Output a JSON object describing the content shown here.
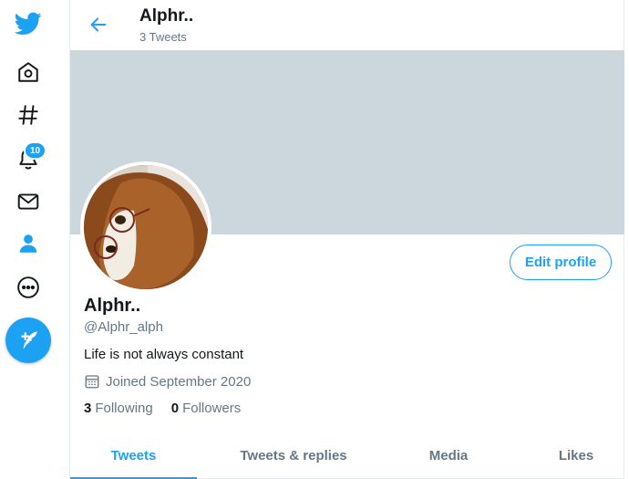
{
  "nav": {
    "items": [
      {
        "icon": "twitter-bird-icon"
      },
      {
        "icon": "home-icon"
      },
      {
        "icon": "explore-hashtag-icon"
      },
      {
        "icon": "notifications-bell-icon"
      },
      {
        "icon": "messages-envelope-icon"
      },
      {
        "icon": "profile-person-icon"
      },
      {
        "icon": "more-ellipsis-icon"
      }
    ],
    "notification_badge": "10",
    "compose_icon": "compose-tweet-icon",
    "accent": "#1da1f2"
  },
  "header": {
    "name": "Alphr..",
    "tweet_count": "3 Tweets"
  },
  "banner": {
    "color": "#ccd6dd"
  },
  "profile": {
    "edit_button": "Edit profile",
    "name": "Alphr..",
    "handle": "@Alphr_alph",
    "bio": "Life is not always constant",
    "joined": "Joined September 2020",
    "following_count": "3",
    "following_label": "Following",
    "followers_count": "0",
    "followers_label": "Followers"
  },
  "tabs": [
    {
      "label": "Tweets",
      "active": true
    },
    {
      "label": "Tweets & replies",
      "active": false
    },
    {
      "label": "Media",
      "active": false
    },
    {
      "label": "Likes",
      "active": false
    }
  ]
}
